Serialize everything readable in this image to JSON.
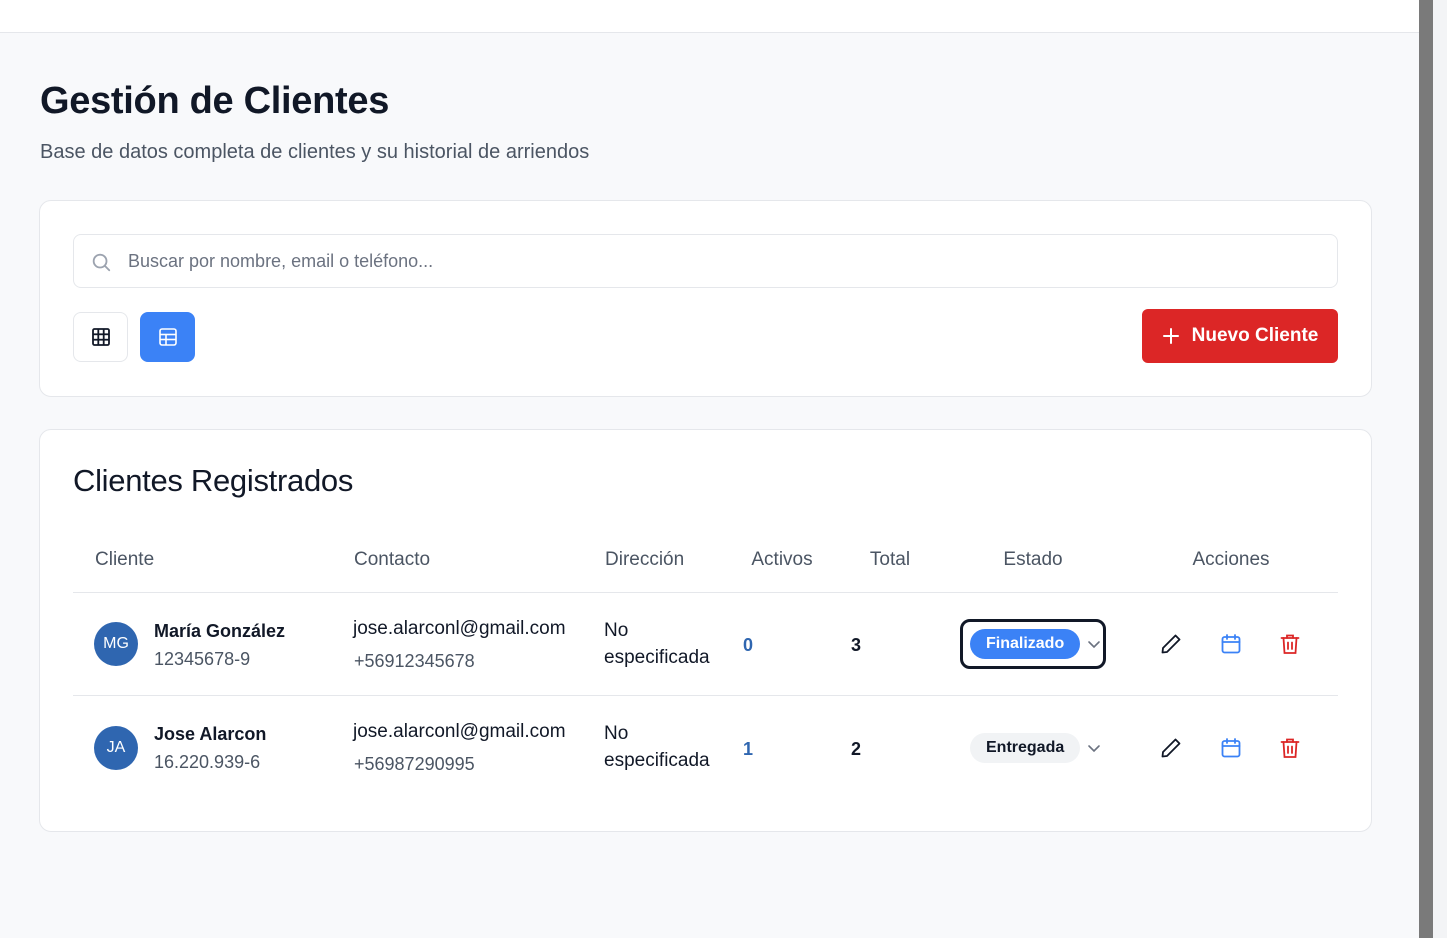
{
  "header": {
    "title": "Gestión de Clientes",
    "subtitle": "Base de datos completa de clientes y su historial de arriendos"
  },
  "search": {
    "placeholder": "Buscar por nombre, email o teléfono...",
    "value": ""
  },
  "toolbar": {
    "grid_view_icon": "grid-icon",
    "table_view_icon": "table-icon",
    "new_client_label": "Nuevo Cliente"
  },
  "table": {
    "title": "Clientes Registrados",
    "columns": [
      "Cliente",
      "Contacto",
      "Dirección",
      "Activos",
      "Total",
      "Estado",
      "Acciones"
    ],
    "rows": [
      {
        "initials": "MG",
        "name": "María González",
        "id": "12345678-9",
        "email": "jose.alarconl@gmail.com",
        "phone": "+56912345678",
        "address_line1": "No",
        "address_line2": "especificada",
        "activos": "0",
        "total": "3",
        "status": "Finalizado"
      },
      {
        "initials": "JA",
        "name": "Jose Alarcon",
        "id": "16.220.939-6",
        "email": "jose.alarconl@gmail.com",
        "phone": "+56987290995",
        "address_line1": "No",
        "address_line2": "especificada",
        "activos": "1",
        "total": "2",
        "status": "Entregada"
      }
    ]
  },
  "colors": {
    "accent_blue": "#3b82f6",
    "danger_red": "#dc2626",
    "avatar_blue": "#2f66b0"
  }
}
